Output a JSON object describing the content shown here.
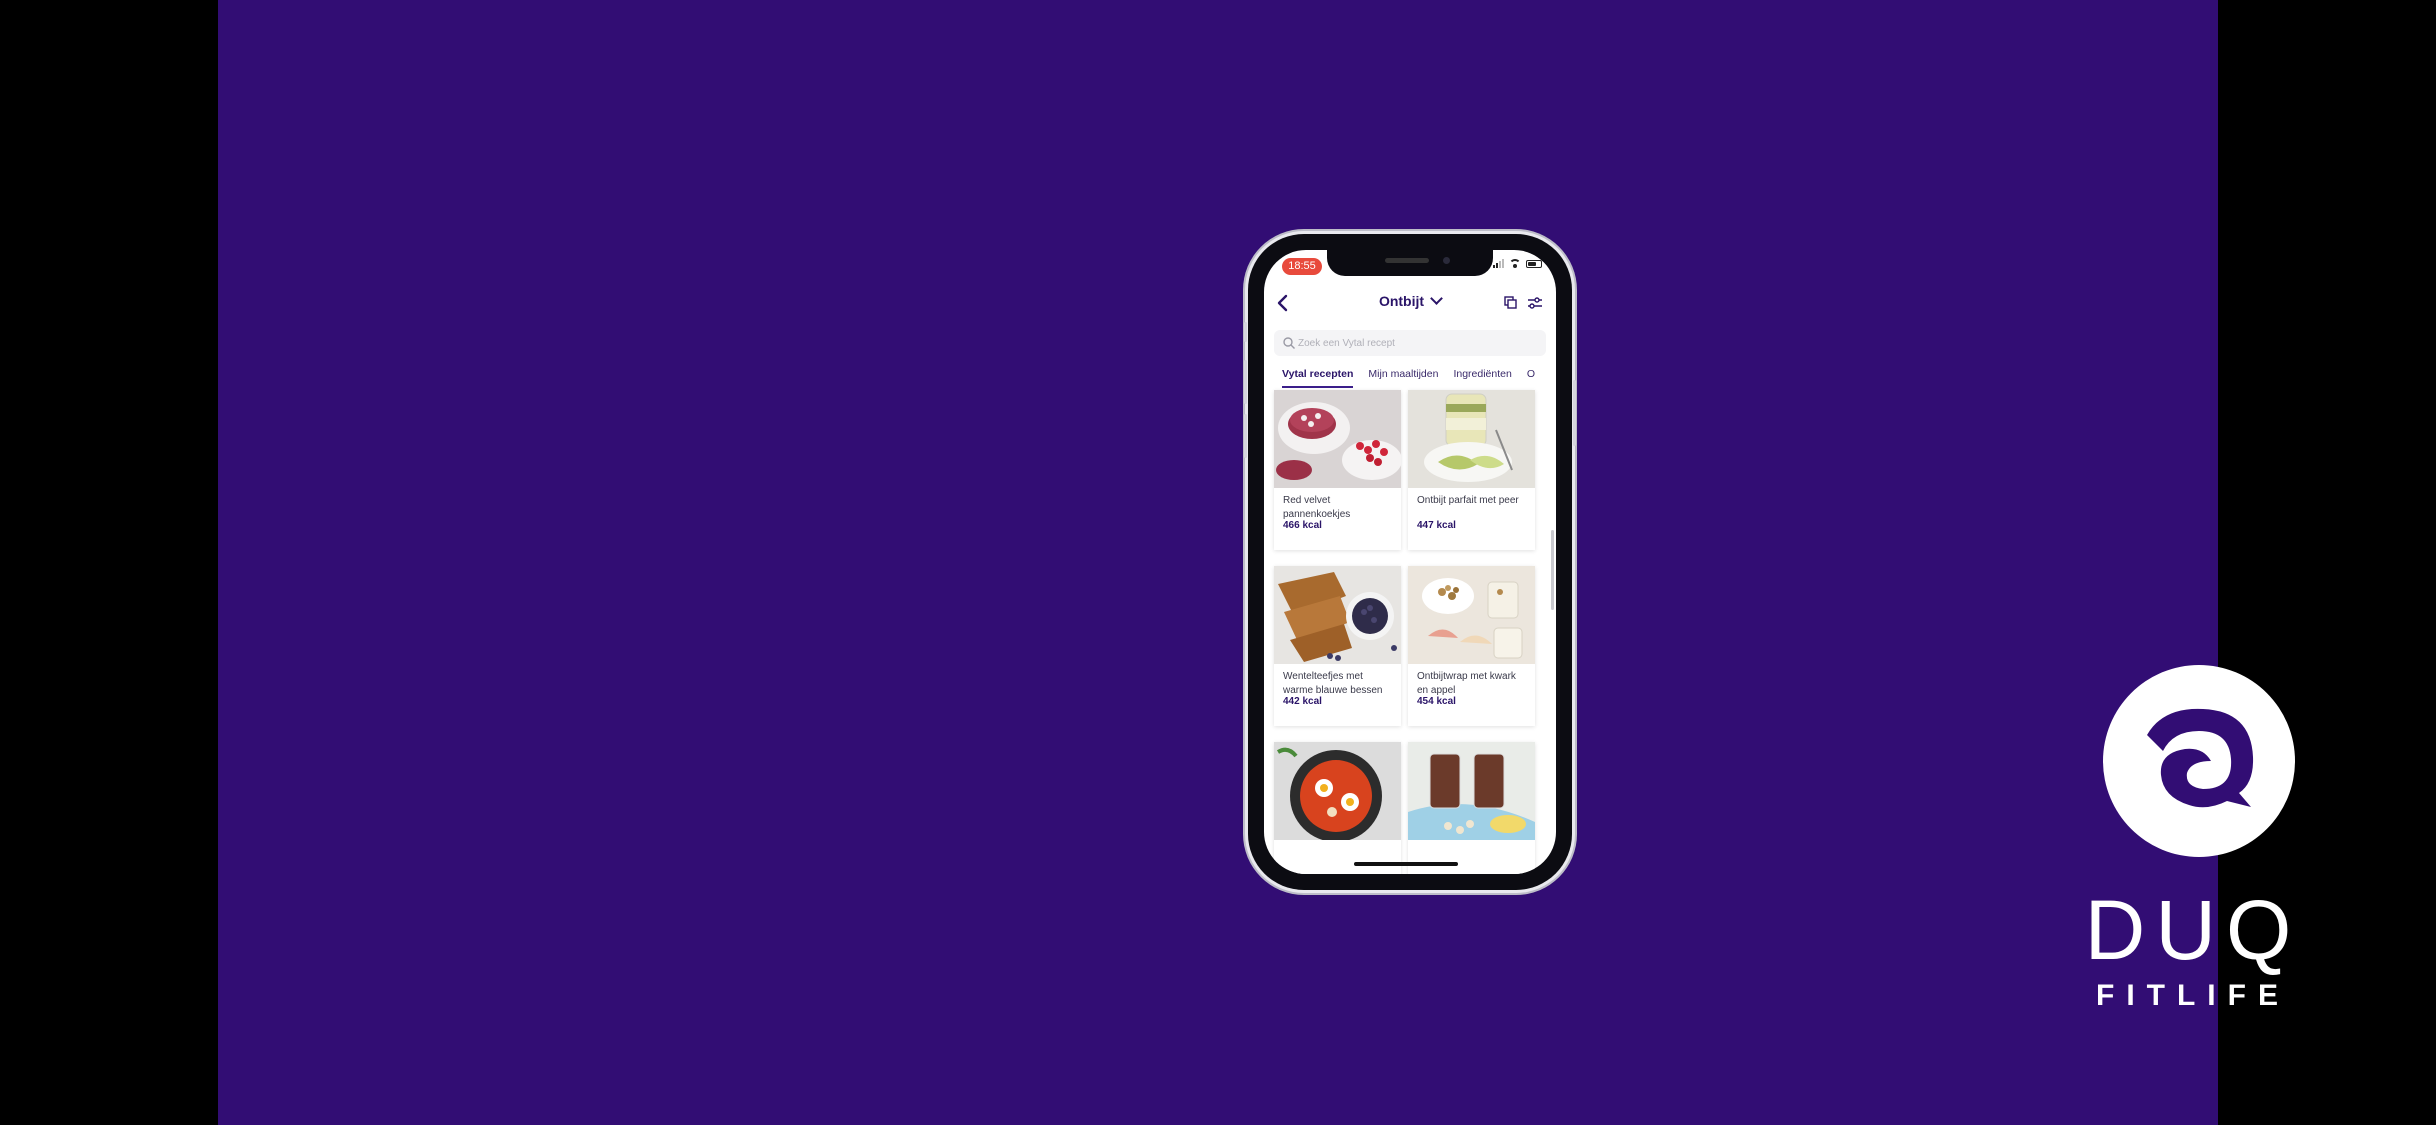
{
  "status_bar": {
    "time": "18:55"
  },
  "nav": {
    "title": "Ontbijt"
  },
  "search": {
    "placeholder": "Zoek een Vytal recept"
  },
  "tabs": [
    {
      "label": "Vytal recepten",
      "active": true
    },
    {
      "label": "Mijn maaltijden",
      "active": false
    },
    {
      "label": "Ingrediënten",
      "active": false
    },
    {
      "label": "O",
      "active": false
    }
  ],
  "recipes": [
    {
      "name": "Red velvet pannenkoekjes",
      "kcal": "466 kcal"
    },
    {
      "name": "Ontbijt parfait met peer",
      "kcal": "447 kcal"
    },
    {
      "name": "Wentelteefjes met warme blauwe bessen",
      "kcal": "442 kcal"
    },
    {
      "name": "Ontbijtwrap met kwark en appel",
      "kcal": "454 kcal"
    },
    {
      "name": "",
      "kcal": ""
    },
    {
      "name": "",
      "kcal": ""
    }
  ],
  "brand": {
    "name": "DUQ",
    "tagline": "FITLIFE"
  },
  "colors": {
    "background": "#320d74",
    "accent": "#2a1468",
    "time_pill": "#e84a3c"
  }
}
